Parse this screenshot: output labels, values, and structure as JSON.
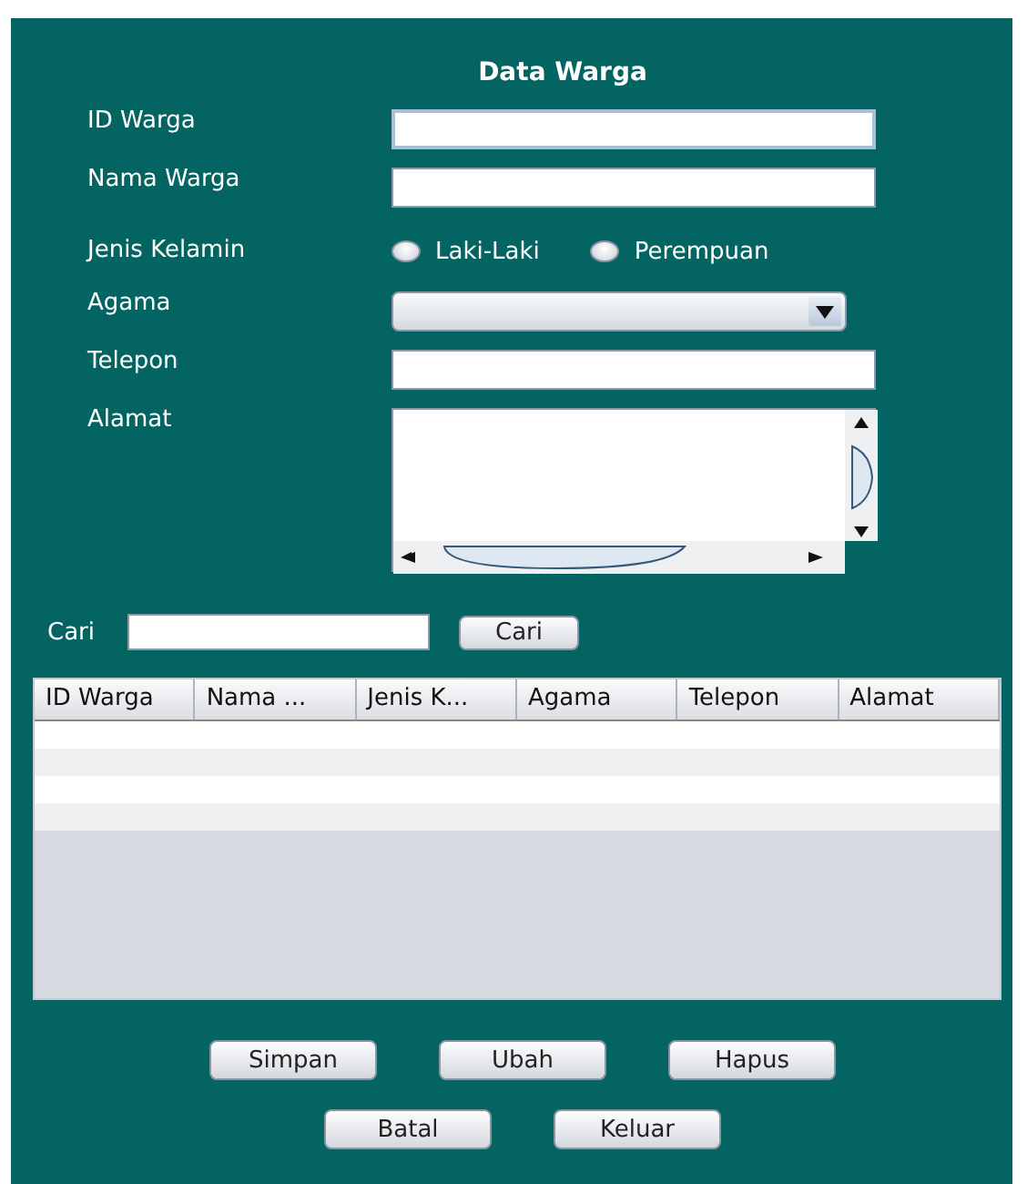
{
  "title": "Data Warga",
  "fields": [
    {
      "label": "ID Warga",
      "kind": "text",
      "focused": true
    },
    {
      "label": "Nama Warga",
      "kind": "text",
      "focused": false
    },
    {
      "label": "Jenis Kelamin",
      "kind": "radio",
      "options": [
        {
          "label": "Laki-Laki",
          "selected": false
        },
        {
          "label": "Perempuan",
          "selected": false
        }
      ]
    },
    {
      "label": "Agama",
      "kind": "combo"
    },
    {
      "label": "Telepon",
      "kind": "text",
      "focused": false
    },
    {
      "label": "Alamat",
      "kind": "textarea"
    }
  ],
  "search": {
    "label": "Cari",
    "button": "Cari"
  },
  "table": {
    "columns": [
      "ID Warga",
      "Nama ...",
      "Jenis K...",
      "Agama",
      "Telepon",
      "Alamat"
    ]
  },
  "buttons": [
    [
      "Simpan",
      "Ubah",
      "Hapus"
    ],
    [
      "Batal",
      "Keluar"
    ]
  ]
}
